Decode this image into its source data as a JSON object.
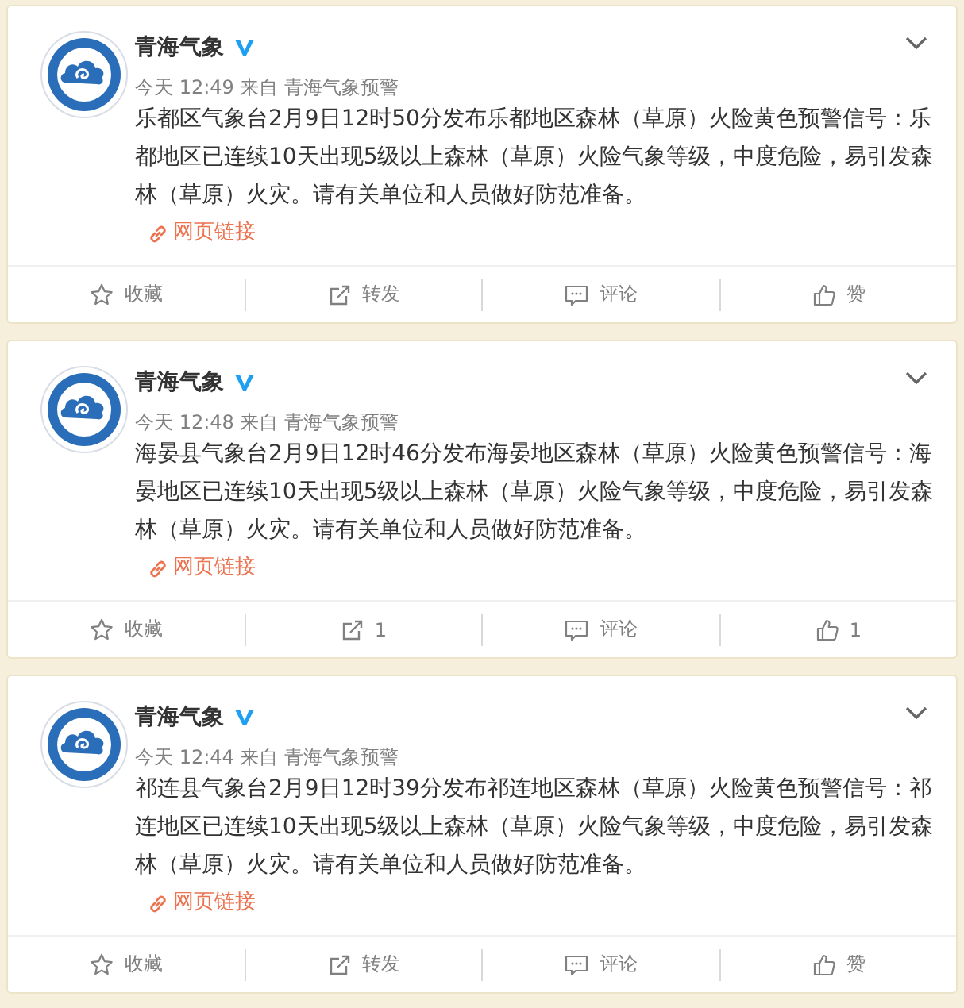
{
  "posts": [
    {
      "author": "青海气象",
      "verified": true,
      "meta": "今天 12:49 来自 青海气象预警",
      "text": "乐都区气象台2月9日12时50分发布乐都地区森林（草原）火险黄色预警信号：乐都地区已连续10天出现5级以上森林（草原）火险气象等级，中度危险，易引发森林（草原）火灾。请有关单位和人员做好防范准备。",
      "link": "网页链接",
      "actions": [
        {
          "kind": "favorite",
          "label": "收藏"
        },
        {
          "kind": "repost",
          "label": "转发"
        },
        {
          "kind": "comment",
          "label": "评论"
        },
        {
          "kind": "like",
          "label": "赞"
        }
      ]
    },
    {
      "author": "青海气象",
      "verified": true,
      "meta": "今天 12:48 来自 青海气象预警",
      "text": "海晏县气象台2月9日12时46分发布海晏地区森林（草原）火险黄色预警信号：海晏地区已连续10天出现5级以上森林（草原）火险气象等级，中度危险，易引发森林（草原）火灾。请有关单位和人员做好防范准备。",
      "link": "网页链接",
      "actions": [
        {
          "kind": "favorite",
          "label": "收藏"
        },
        {
          "kind": "repost",
          "label": "1"
        },
        {
          "kind": "comment",
          "label": "评论"
        },
        {
          "kind": "like",
          "label": "1"
        }
      ]
    },
    {
      "author": "青海气象",
      "verified": true,
      "meta": "今天 12:44 来自 青海气象预警",
      "text": "祁连县气象台2月9日12时39分发布祁连地区森林（草原）火险黄色预警信号：祁连地区已连续10天出现5级以上森林（草原）火险气象等级，中度危险，易引发森林（草原）火灾。请有关单位和人员做好防范准备。",
      "link": "网页链接",
      "actions": [
        {
          "kind": "favorite",
          "label": "收藏"
        },
        {
          "kind": "repost",
          "label": "转发"
        },
        {
          "kind": "comment",
          "label": "评论"
        },
        {
          "kind": "like",
          "label": "赞"
        }
      ]
    }
  ]
}
